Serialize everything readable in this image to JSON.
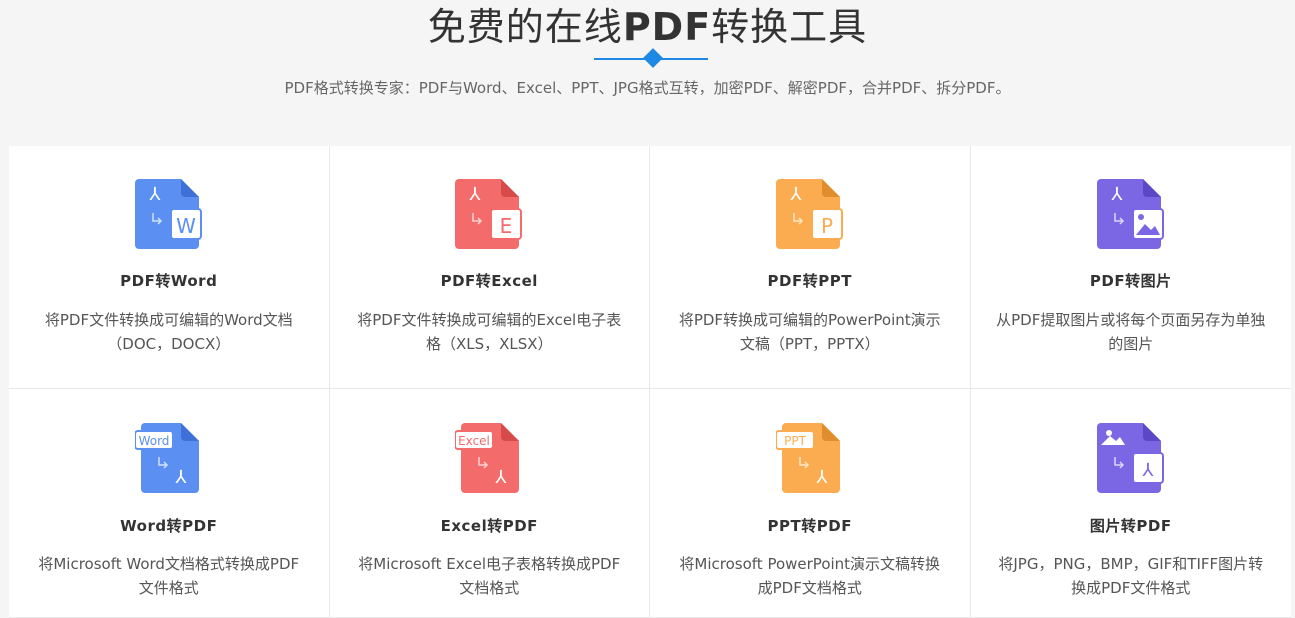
{
  "header": {
    "title_pre": "免费的在线",
    "title_bold": "PDF",
    "title_post": "转换工具",
    "subtitle": "PDF格式转换专家：PDF与Word、Excel、PPT、JPG格式互转，加密PDF、解密PDF，合并PDF、拆分PDF。"
  },
  "colors": {
    "accent": "#1e88e5",
    "word": "#5b8ff2",
    "excel": "#f46b6b",
    "ppt": "#fbac50",
    "image": "#7b66e3"
  },
  "tools": [
    {
      "name": "PDF转Word",
      "desc": "将PDF文件转换成可编辑的Word文档（DOC，DOCX）",
      "icon": "pdf-to-word-icon",
      "badge": "W"
    },
    {
      "name": "PDF转Excel",
      "desc": "将PDF文件转换成可编辑的Excel电子表格（XLS，XLSX）",
      "icon": "pdf-to-excel-icon",
      "badge": "E"
    },
    {
      "name": "PDF转PPT",
      "desc": "将PDF转换成可编辑的PowerPoint演示文稿（PPT，PPTX）",
      "icon": "pdf-to-ppt-icon",
      "badge": "P"
    },
    {
      "name": "PDF转图片",
      "desc": "从PDF提取图片或将每个页面另存为单独的图片",
      "icon": "pdf-to-image-icon",
      "badge": ""
    },
    {
      "name": "Word转PDF",
      "desc": "将Microsoft Word文档格式转换成PDF文件格式",
      "icon": "word-to-pdf-icon",
      "badge": "Word"
    },
    {
      "name": "Excel转PDF",
      "desc": "将Microsoft Excel电子表格转换成PDF文档格式",
      "icon": "excel-to-pdf-icon",
      "badge": "Excel"
    },
    {
      "name": "PPT转PDF",
      "desc": "将Microsoft PowerPoint演示文稿转换成PDF文档格式",
      "icon": "ppt-to-pdf-icon",
      "badge": "PPT"
    },
    {
      "name": "图片转PDF",
      "desc": "将JPG，PNG，BMP，GIF和TIFF图片转换成PDF文件格式",
      "icon": "image-to-pdf-icon",
      "badge": ""
    }
  ]
}
